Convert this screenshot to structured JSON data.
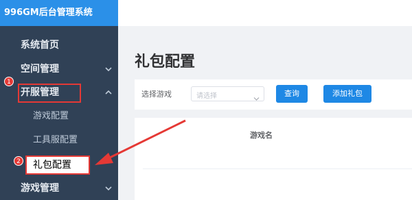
{
  "app": {
    "title": "996GM后台管理系统"
  },
  "sidebar": {
    "items": [
      {
        "label": "系统首页"
      },
      {
        "label": "空间管理"
      },
      {
        "label": "开服管理"
      },
      {
        "label": "游戏配置"
      },
      {
        "label": "工具服配置"
      },
      {
        "label": "礼包配置"
      },
      {
        "label": "游戏管理"
      }
    ]
  },
  "annotations": {
    "step1": "1",
    "step2": "2",
    "color": "#e53935"
  },
  "main": {
    "page_title": "礼包配置",
    "filter": {
      "label": "选择游戏",
      "placeholder": "请选择",
      "query_button": "查询",
      "add_button": "添加礼包"
    },
    "table": {
      "columns": [
        "游戏名"
      ]
    }
  },
  "colors": {
    "sidebar_bg": "#304156",
    "brand_bg": "#2b90e8",
    "primary": "#1e88e5"
  }
}
